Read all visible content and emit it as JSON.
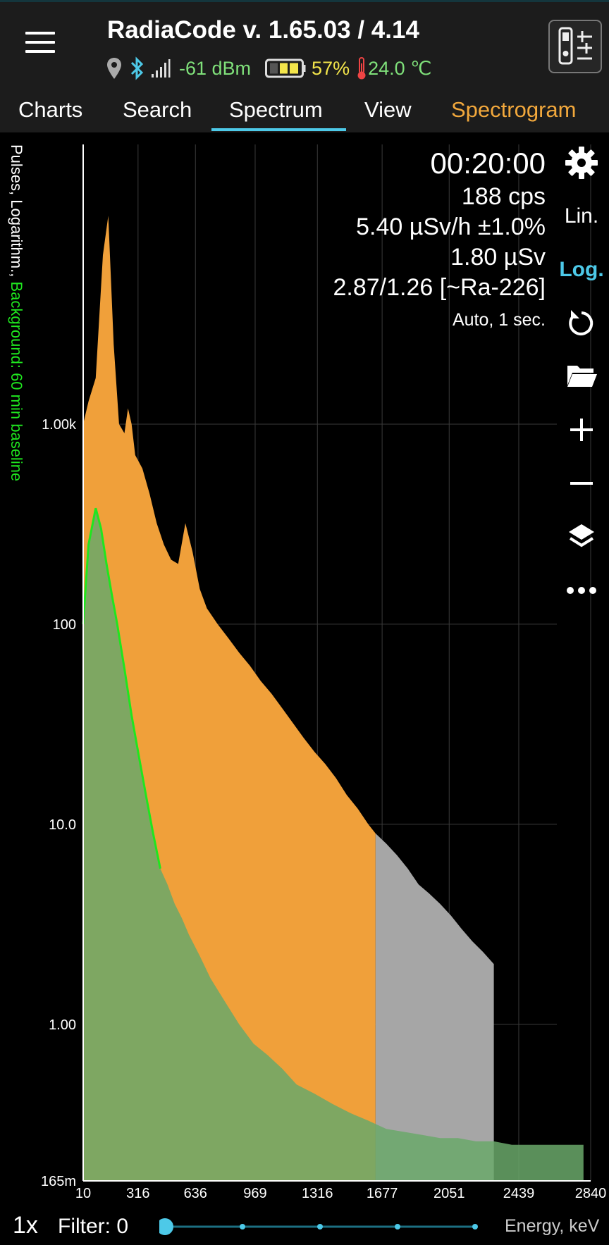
{
  "header": {
    "title": "RadiaCode v. 1.65.03 / 4.14",
    "signal": "-61 dBm",
    "battery": "57%",
    "temperature": "24.0 ℃"
  },
  "tabs": [
    {
      "label": "Charts"
    },
    {
      "label": "Search"
    },
    {
      "label": "Spectrum"
    },
    {
      "label": "View"
    },
    {
      "label": "Spectrogram"
    }
  ],
  "colors": {
    "accent": "#4dc9e8",
    "spectrogram_tab": "#f2a83c",
    "spectrum_fill": "#f0a03a",
    "background_line": "#1fe61f",
    "background_fill": "#6aa86a",
    "gray_fill": "#a6a6a6",
    "signal": "#7fe07a",
    "battery": "#f3e54b"
  },
  "readout": {
    "time": "00:20:00",
    "cps": "188 cps",
    "dose_rate": "5.40 µSv/h ±1.0%",
    "dose": "1.80 µSv",
    "ratio": "2.87/1.26 [~Ra-226]",
    "mode": "Auto, 1 sec."
  },
  "toolbar": {
    "lin_label": "Lin.",
    "log_label": "Log.",
    "icons": [
      "gear-icon",
      "reset-icon",
      "folder-icon",
      "plus-icon",
      "minus-icon",
      "layers-icon",
      "more-icon"
    ]
  },
  "chart_data": {
    "type": "area",
    "ylabel_prefix": "Pulses, Logarithm., ",
    "ylabel_background": "Background: 60 min baseline",
    "xlabel": "Energy, keV",
    "x_ticks": [
      "10",
      "316",
      "636",
      "969",
      "1316",
      "1677",
      "2051",
      "2439",
      "2840"
    ],
    "x_tick_values": [
      10,
      316,
      636,
      969,
      1316,
      1677,
      2051,
      2439,
      2840
    ],
    "y_ticks": [
      "1.00k",
      "100",
      "10.0",
      "1.00",
      "165m"
    ],
    "y_tick_values": [
      1000,
      100,
      10,
      1,
      0.165
    ],
    "yscale": "log",
    "xlim": [
      10,
      2840
    ],
    "ylim": [
      0.165,
      25000
    ],
    "grid": true,
    "series": [
      {
        "name": "",
        "x": [
          10,
          40,
          80,
          120,
          150,
          180,
          210,
          240,
          260,
          280,
          300,
          340,
          380,
          420,
          460,
          500,
          540,
          580,
          620,
          660,
          700,
          760,
          820,
          880,
          940,
          1000,
          1060,
          1120,
          1180,
          1240,
          1300,
          1360,
          1420,
          1480,
          1540,
          1600,
          1640
        ],
        "y": [
          1000,
          1300,
          1700,
          7000,
          11000,
          2500,
          1000,
          900,
          1200,
          1000,
          700,
          600,
          450,
          320,
          250,
          210,
          200,
          320,
          230,
          150,
          120,
          100,
          85,
          72,
          62,
          52,
          45,
          38,
          32,
          27,
          23,
          20,
          17,
          14,
          12,
          10,
          9
        ]
      },
      {
        "name": "Background: 60 min baseline",
        "x": [
          10,
          40,
          80,
          110,
          140,
          170,
          200,
          240,
          280,
          320,
          360,
          400,
          440,
          480,
          520,
          560,
          600,
          660,
          720,
          800,
          880,
          960,
          1040,
          1120,
          1200,
          1300,
          1400,
          1500,
          1600,
          1700,
          1800,
          1900,
          2000,
          2100,
          2200,
          2300,
          2400,
          2500,
          2600,
          2700,
          2800
        ],
        "y": [
          100,
          250,
          380,
          300,
          200,
          140,
          100,
          60,
          35,
          22,
          14,
          9,
          6,
          5,
          4,
          3.4,
          2.8,
          2.2,
          1.7,
          1.3,
          1.0,
          0.8,
          0.7,
          0.6,
          0.5,
          0.45,
          0.4,
          0.36,
          0.33,
          0.3,
          0.29,
          0.28,
          0.27,
          0.27,
          0.26,
          0.26,
          0.25,
          0.25,
          0.25,
          0.25,
          0.25
        ]
      }
    ],
    "gray_region": {
      "x": [
        1640,
        1700,
        1760,
        1820,
        1880,
        1940,
        2000,
        2060,
        2120,
        2180,
        2240,
        2300
      ],
      "y": [
        9,
        8,
        7,
        6,
        5,
        4.5,
        4,
        3.5,
        3,
        2.6,
        2.3,
        2
      ]
    }
  },
  "bottom": {
    "zoom": "1x",
    "filter": "Filter: 0",
    "slider_value": 0,
    "slider_steps": 5
  }
}
